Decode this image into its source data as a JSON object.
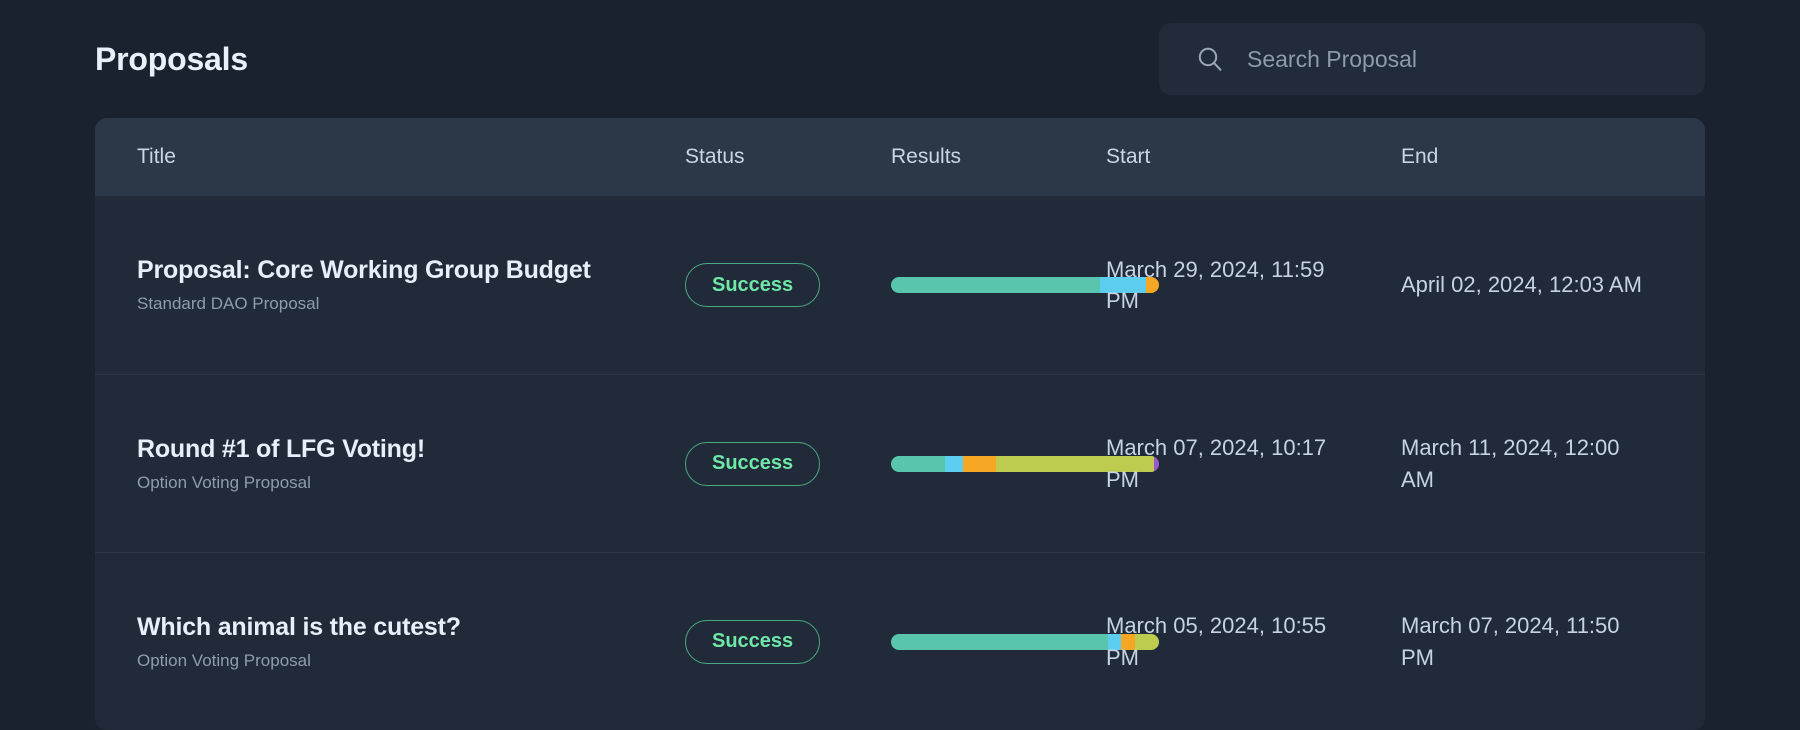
{
  "header": {
    "title": "Proposals"
  },
  "search": {
    "placeholder": "Search Proposal",
    "value": "",
    "icon": "search-icon"
  },
  "table": {
    "columns": [
      "Title",
      "Status",
      "Results",
      "Start",
      "End"
    ],
    "rows": [
      {
        "title": "Proposal: Core Working Group Budget",
        "subtitle": "Standard DAO Proposal",
        "status": "Success",
        "start": "March 29, 2024, 11:59 PM",
        "end": "April 02, 2024, 12:03 AM",
        "results": [
          {
            "color": "#58c5ac",
            "percent": 78
          },
          {
            "color": "#5ccdee",
            "percent": 17
          },
          {
            "color": "#f5a623",
            "percent": 5
          }
        ]
      },
      {
        "title": "Round #1 of LFG Voting!",
        "subtitle": "Option Voting Proposal",
        "status": "Success",
        "start": "March 07, 2024, 10:17 PM",
        "end": "March 11, 2024, 12:00 AM",
        "results": [
          {
            "color": "#58c5ac",
            "percent": 20
          },
          {
            "color": "#5ccdee",
            "percent": 7
          },
          {
            "color": "#f5a623",
            "percent": 12
          },
          {
            "color": "#bdcc4e",
            "percent": 59
          },
          {
            "color": "#9b59d0",
            "percent": 2
          }
        ]
      },
      {
        "title": "Which animal is the cutest?",
        "subtitle": "Option Voting Proposal",
        "status": "Success",
        "start": "March 05, 2024, 10:55 PM",
        "end": "March 07, 2024, 11:50 PM",
        "results": [
          {
            "color": "#58c5ac",
            "percent": 81
          },
          {
            "color": "#5ccdee",
            "percent": 5
          },
          {
            "color": "#f5a623",
            "percent": 5
          },
          {
            "color": "#bdcc4e",
            "percent": 9
          }
        ]
      }
    ]
  },
  "theme": {
    "background": "#1a2230",
    "card": "#212a38",
    "header_row": "#2c3748",
    "accent_success": "#6ee7a8",
    "text_primary": "#e6f0fa",
    "text_secondary": "#8e9cad"
  }
}
